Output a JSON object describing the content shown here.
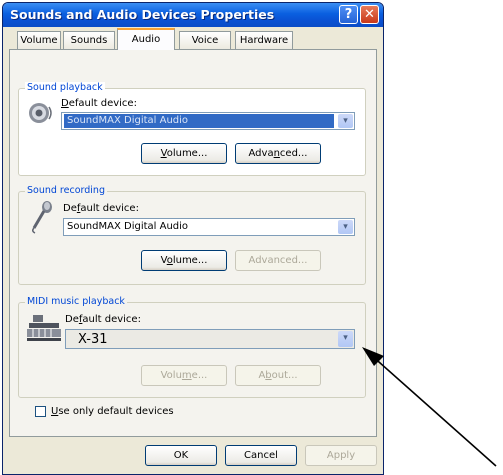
{
  "window": {
    "title": "Sounds and Audio Devices Properties"
  },
  "titlebar": {
    "help_glyph": "?",
    "close_glyph": "✕"
  },
  "tabs": [
    {
      "label": "Volume"
    },
    {
      "label": "Sounds"
    },
    {
      "label": "Audio"
    },
    {
      "label": "Voice"
    },
    {
      "label": "Hardware"
    }
  ],
  "active_tab": "Audio",
  "sound_playback": {
    "legend": "Sound playback",
    "device_label_prefix": "D",
    "device_label_rest": "efault device:",
    "device_value": "SoundMAX Digital Audio",
    "volume_prefix": "V",
    "volume_rest": "olume...",
    "advanced_prefix": "Adva",
    "advanced_mid": "n",
    "advanced_rest": "ced..."
  },
  "sound_recording": {
    "legend": "Sound recording",
    "device_label_prefix": "De",
    "device_label_mid": "f",
    "device_label_rest": "ault device:",
    "device_value": "SoundMAX Digital Audio",
    "volume_prefix": "V",
    "volume_mid": "o",
    "volume_rest": "lume...",
    "advanced_label": "Advanced..."
  },
  "midi_playback": {
    "legend": "MIDI music playback",
    "device_label_prefix": "De",
    "device_label_mid": "f",
    "device_label_rest": "ault device:",
    "device_value": "X-31",
    "volume_prefix": "Volu",
    "volume_mid": "m",
    "volume_rest": "e...",
    "about_prefix": "A",
    "about_mid": "b",
    "about_rest": "out..."
  },
  "use_default_prefix": "U",
  "use_default_rest": "se only default devices",
  "buttons": {
    "ok": "OK",
    "cancel": "Cancel",
    "apply": "Apply"
  },
  "dropdown_glyph": "▾",
  "colors": {
    "title_bar": "#0a52d4",
    "selection": "#316ac5",
    "group_legend": "#0046d5",
    "active_tab_accent": "#f7a234"
  }
}
